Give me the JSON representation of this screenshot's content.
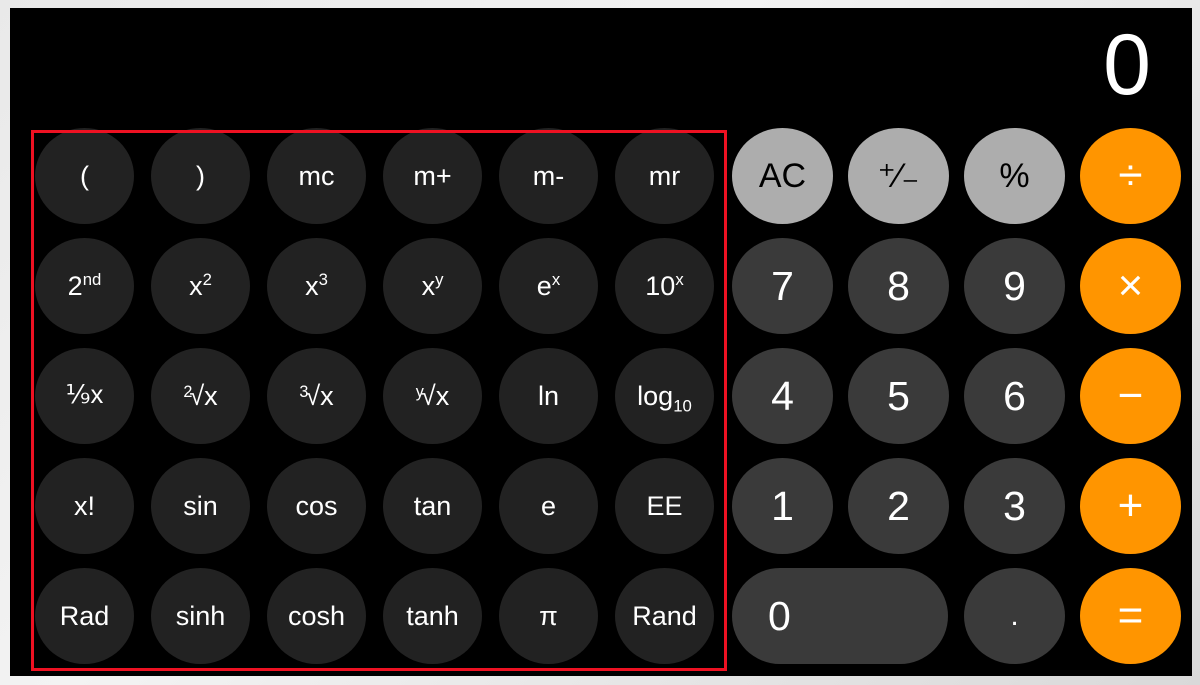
{
  "app": {
    "name": "Calculator",
    "mode": "scientific"
  },
  "display": {
    "value": "0"
  },
  "colors": {
    "background": "#000000",
    "scientific_key": "#222222",
    "number_key": "#3a3a3a",
    "function_key": "#adadad",
    "operator_key": "#ff9500",
    "text_light": "#ffffff",
    "text_dark": "#000000",
    "annotation": "#ee1122"
  },
  "annotation": {
    "name": "scientific-keypad-highlight",
    "shape": "rectangle",
    "color": "#ee1122"
  },
  "scientific_pad": {
    "rows": [
      [
        {
          "name": "open-paren",
          "label": "("
        },
        {
          "name": "close-paren",
          "label": ")"
        },
        {
          "name": "memory-clear",
          "label": "mc"
        },
        {
          "name": "memory-add",
          "label": "m+"
        },
        {
          "name": "memory-subtract",
          "label": "m-"
        },
        {
          "name": "memory-recall",
          "label": "mr"
        }
      ],
      [
        {
          "name": "second-function",
          "label": "2",
          "sup": "nd"
        },
        {
          "name": "x-squared",
          "label": "x",
          "sup": "2"
        },
        {
          "name": "x-cubed",
          "label": "x",
          "sup": "3"
        },
        {
          "name": "x-to-the-y",
          "label": "x",
          "sup": "y"
        },
        {
          "name": "e-to-the-x",
          "label": "e",
          "sup": "x"
        },
        {
          "name": "ten-to-the-x",
          "label": "10",
          "sup": "x"
        }
      ],
      [
        {
          "name": "reciprocal",
          "label": "⅑x"
        },
        {
          "name": "square-root",
          "root_index": "2",
          "root_body": "√x"
        },
        {
          "name": "cube-root",
          "root_index": "3",
          "root_body": "√x"
        },
        {
          "name": "y-root-of-x",
          "root_index": "y",
          "root_body": "√x"
        },
        {
          "name": "natural-log",
          "label": "ln"
        },
        {
          "name": "log-base-ten",
          "label": "log",
          "sub": "10"
        }
      ],
      [
        {
          "name": "factorial",
          "label": "x!"
        },
        {
          "name": "sine",
          "label": "sin"
        },
        {
          "name": "cosine",
          "label": "cos"
        },
        {
          "name": "tangent",
          "label": "tan"
        },
        {
          "name": "eulers-number",
          "label": "e"
        },
        {
          "name": "exponent-entry",
          "label": "EE"
        }
      ],
      [
        {
          "name": "radians-toggle",
          "label": "Rad"
        },
        {
          "name": "hyperbolic-sine",
          "label": "sinh"
        },
        {
          "name": "hyperbolic-cosine",
          "label": "cosh"
        },
        {
          "name": "hyperbolic-tangent",
          "label": "tanh"
        },
        {
          "name": "pi-constant",
          "label": "π"
        },
        {
          "name": "random-number",
          "label": "Rand"
        }
      ]
    ]
  },
  "numeric_pad": {
    "clear": "AC",
    "sign_toggle": "⁺⁄₋",
    "percent": "%",
    "divide": "÷",
    "seven": "7",
    "eight": "8",
    "nine": "9",
    "multiply": "×",
    "four": "4",
    "five": "5",
    "six": "6",
    "subtract": "−",
    "one": "1",
    "two": "2",
    "three": "3",
    "add": "+",
    "zero": "0",
    "decimal": ".",
    "equals": "="
  }
}
